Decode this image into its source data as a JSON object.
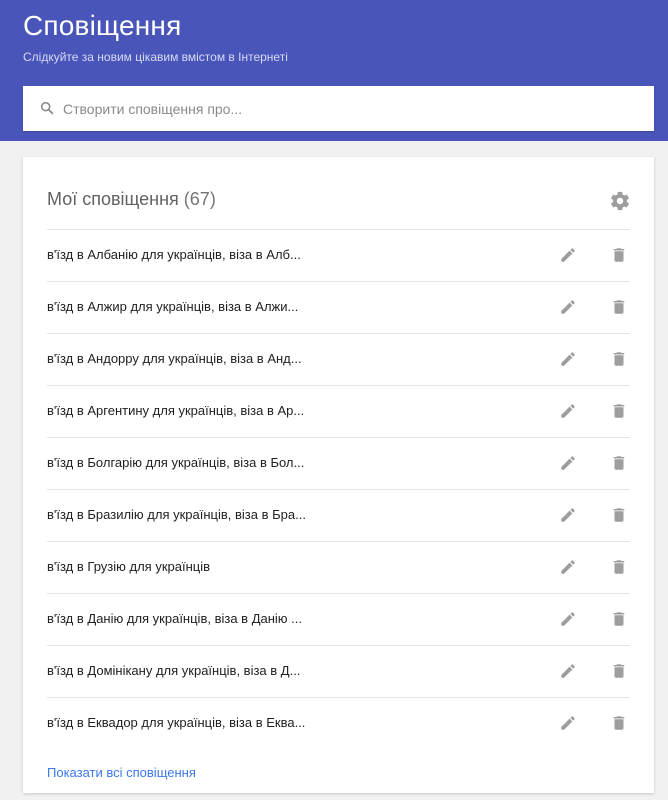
{
  "header": {
    "title": "Сповіщення",
    "subtitle": "Слідкуйте за новим цікавим вмістом в Інтернеті",
    "bg_color": "#4a55ba"
  },
  "search": {
    "placeholder": "Створити сповіщення про...",
    "value": "",
    "icon": "search-icon"
  },
  "alerts": {
    "title": "Мої сповіщення",
    "count": "(67)",
    "settings_icon": "gear-icon",
    "items": [
      {
        "label": "в'їзд в Албанію для українців, віза в Алб..."
      },
      {
        "label": "в'їзд в Алжир для українців, віза в Алжи..."
      },
      {
        "label": "в'їзд в Андорру для українців, віза в Анд..."
      },
      {
        "label": "в'їзд в Аргентину для українців, віза в Ар..."
      },
      {
        "label": "в'їзд в Болгарію для українців, віза в Бол..."
      },
      {
        "label": "в'їзд в Бразилію для українців, віза в Бра..."
      },
      {
        "label": "в'їзд в Грузію для українців"
      },
      {
        "label": "в'їзд в Данію для українців, віза в Данію ..."
      },
      {
        "label": "в'їзд в Домінікану для українців, віза в Д..."
      },
      {
        "label": "в'їзд в Еквадор для українців, віза в Еква..."
      }
    ],
    "edit_icon": "pencil-icon",
    "delete_icon": "trash-icon",
    "show_all_label": "Показати всі сповіщення",
    "link_color": "#3b78e7"
  }
}
